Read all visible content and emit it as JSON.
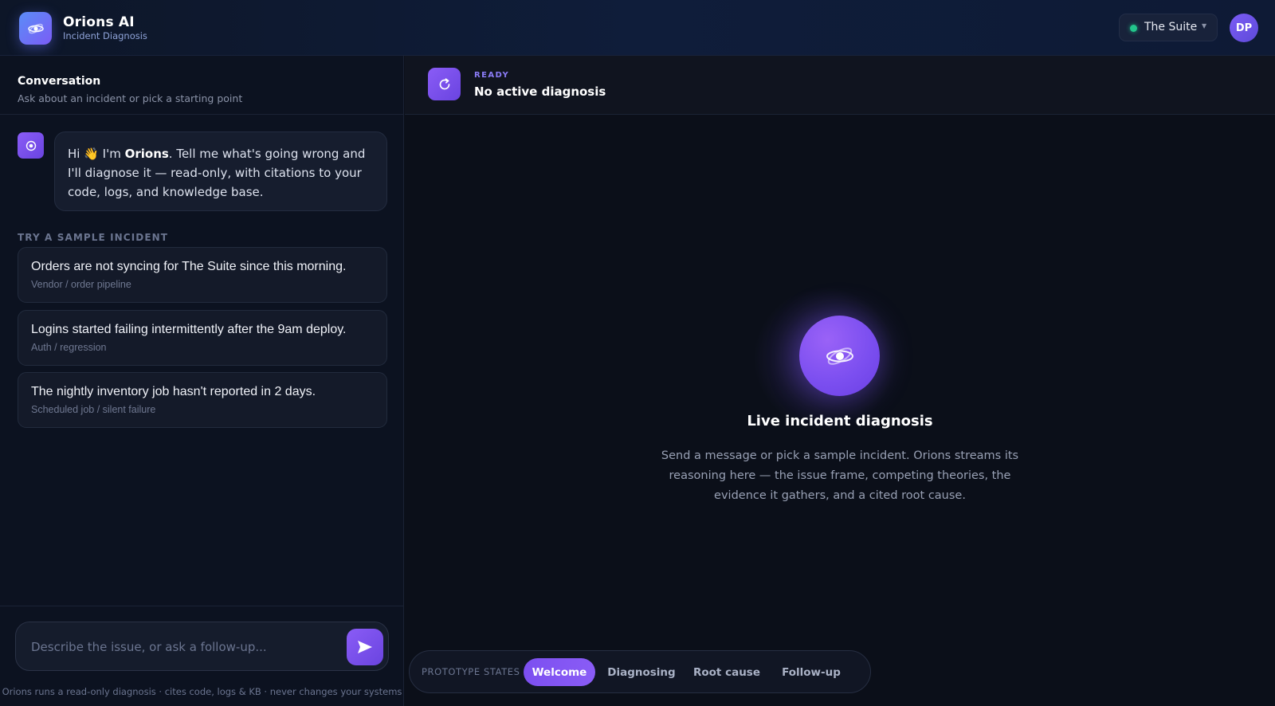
{
  "header": {
    "app_title": "Orions AI",
    "app_subtitle": "Incident Diagnosis",
    "logo_icon": "atom-icon",
    "workspace": {
      "name": "The Suite",
      "status_color": "#22c58b",
      "caret_icon": "chevron-down-icon"
    },
    "avatar_initials": "DP"
  },
  "conversation": {
    "title": "Conversation",
    "subtitle": "Ask about an incident or pick a starting point",
    "welcome": {
      "greeting": "Hi 👋 I'm ",
      "bot_name": "Orions",
      "body": ". Tell me what's going wrong and I'll diagnose it — read-only, with citations to your code, logs, and knowledge base."
    },
    "samples_label": "TRY A SAMPLE INCIDENT",
    "samples": [
      {
        "title": "Orders are not syncing for The Suite since this morning.",
        "tag": "Vendor / order pipeline"
      },
      {
        "title": "Logins started failing intermittently after the 9am deploy.",
        "tag": "Auth / regression"
      },
      {
        "title": "The nightly inventory job hasn't reported in 2 days.",
        "tag": "Scheduled job / silent failure"
      }
    ],
    "composer": {
      "placeholder": "Describe the issue, or ask a follow-up...",
      "value": "",
      "send_icon": "send-icon"
    },
    "footnote": "Orions runs a read-only diagnosis · cites code, logs & KB · never changes your systems"
  },
  "diagnosis": {
    "status_label": "READY",
    "status_title": "No active diagnosis",
    "status_icon": "refresh-icon",
    "hero_title": "Live incident diagnosis",
    "hero_body": "Send a message or pick a sample incident. Orions streams its reasoning here — the issue frame, competing theories, the evidence it gathers, and a cited root cause."
  },
  "prototype": {
    "label": "PROTOTYPE STATES",
    "tabs": [
      "Welcome",
      "Diagnosing",
      "Root cause",
      "Follow-up"
    ],
    "active": "Welcome"
  },
  "colors": {
    "accent": "#7c4ff0",
    "accent_light": "#8a5cf6",
    "brand_blue": "#5b8df7",
    "status_green": "#22c58b"
  }
}
